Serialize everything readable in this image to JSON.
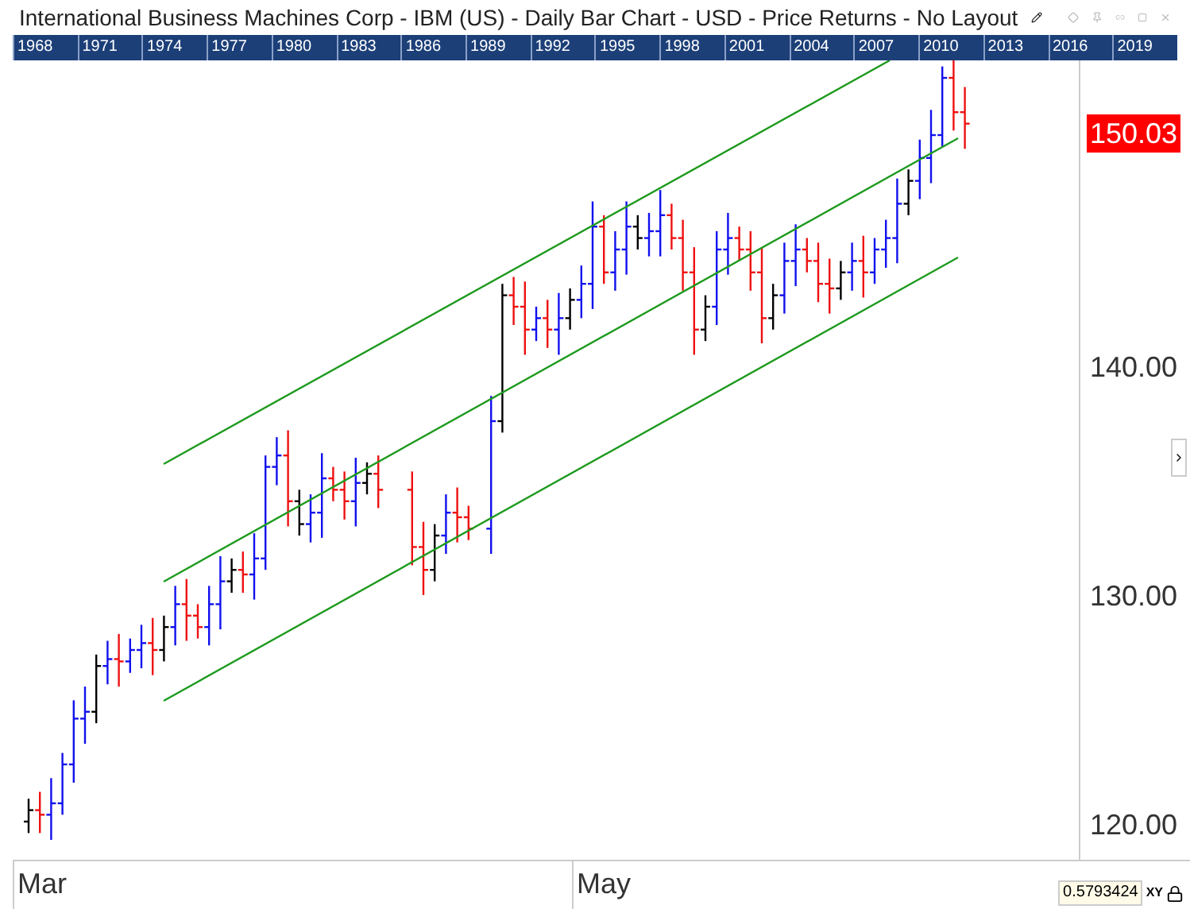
{
  "window": {
    "title": "International Business Machines Corp - IBM (US) - Daily Bar Chart - USD - Price Returns - No Layout"
  },
  "timeline": {
    "years": [
      "1968",
      "1971",
      "1974",
      "1977",
      "1980",
      "1983",
      "1986",
      "1989",
      "1992",
      "1995",
      "1998",
      "2001",
      "2004",
      "2007",
      "2010",
      "2013",
      "2016",
      "2019"
    ]
  },
  "price_axis": {
    "labels": [
      "140.00",
      "130.00",
      "120.00"
    ],
    "last_price": "150.03"
  },
  "date_axis": {
    "labels": [
      "Mar",
      "May"
    ]
  },
  "scale_field": {
    "value": "0.5793424",
    "mode": "XY",
    "locked": true
  }
}
